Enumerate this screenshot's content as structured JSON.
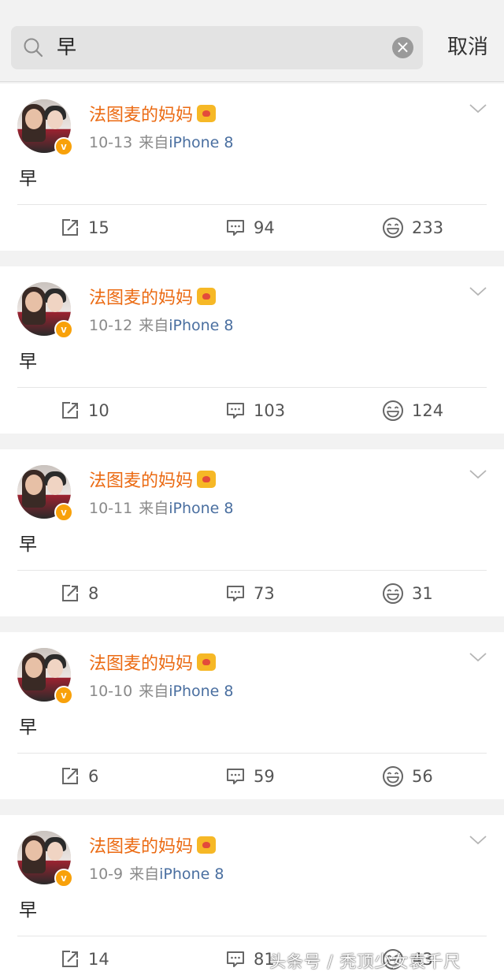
{
  "search": {
    "query": "早",
    "cancel_label": "取消",
    "clear_symbol": "×"
  },
  "accent_colors": {
    "username": "#eb6a12",
    "device": "#4a6fa0",
    "verify_badge": "#f8a10a"
  },
  "posts": [
    {
      "author": "法图麦的妈妈",
      "time": "10-13",
      "source_prefix": "来自",
      "device": "iPhone 8",
      "text": "早",
      "reposts": "15",
      "comments": "94",
      "likes": "233"
    },
    {
      "author": "法图麦的妈妈",
      "time": "10-12",
      "source_prefix": "来自",
      "device": "iPhone 8",
      "text": "早",
      "reposts": "10",
      "comments": "103",
      "likes": "124"
    },
    {
      "author": "法图麦的妈妈",
      "time": "10-11",
      "source_prefix": "来自",
      "device": "iPhone 8",
      "text": "早",
      "reposts": "8",
      "comments": "73",
      "likes": "31"
    },
    {
      "author": "法图麦的妈妈",
      "time": "10-10",
      "source_prefix": "来自",
      "device": "iPhone 8",
      "text": "早",
      "reposts": "6",
      "comments": "59",
      "likes": "56"
    },
    {
      "author": "法图麦的妈妈",
      "time": "10-9",
      "source_prefix": "来自",
      "device": "iPhone 8",
      "text": "早",
      "reposts": "14",
      "comments": "81",
      "likes": "43"
    }
  ],
  "icons": {
    "search": "search-icon",
    "clear": "clear-icon",
    "verified": "verified-badge-icon",
    "crown": "vip-crown-icon",
    "more": "chevron-down-icon",
    "repost": "repost-icon",
    "comment": "comment-icon",
    "like": "like-icon"
  },
  "verify_mark": "v",
  "watermark": "头条号 / 秃顶少女袁千尺"
}
